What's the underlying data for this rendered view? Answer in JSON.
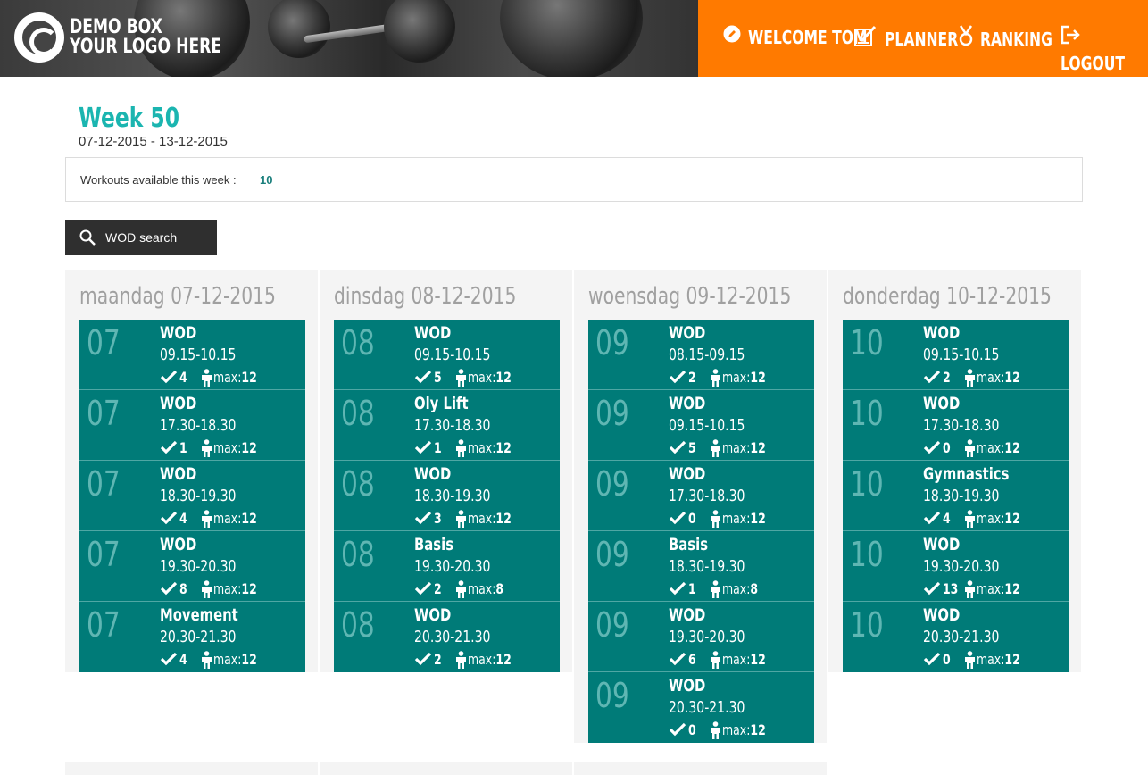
{
  "header": {
    "logo_line1": "DEMO BOX",
    "logo_line2": "YOUR LOGO HERE",
    "nav": [
      {
        "label": "WELCOME TOM",
        "icon": "pencil-icon"
      },
      {
        "label": "PLANNER",
        "icon": "checklist-icon"
      },
      {
        "label": "RANKING",
        "icon": "medal-icon"
      },
      {
        "label": "LOGOUT",
        "icon": "logout-icon"
      }
    ]
  },
  "colors": {
    "accent": "#ff7a00",
    "teal": "#007b78",
    "title": "#1bb5b0"
  },
  "week": {
    "title": "Week 50",
    "range": "07-12-2015 - 13-12-2015",
    "available_label": "Workouts available this week :",
    "available_count": "10"
  },
  "search": {
    "label": "WOD search",
    "icon": "search-icon"
  },
  "days": [
    {
      "title": "maandag 07-12-2015",
      "slots": [
        {
          "day": "07",
          "name": "WOD",
          "time": "09.15-10.15",
          "count": "4",
          "max_label": "max:",
          "max": "12"
        },
        {
          "day": "07",
          "name": "WOD",
          "time": "17.30-18.30",
          "count": "1",
          "max_label": "max:",
          "max": "12"
        },
        {
          "day": "07",
          "name": "WOD",
          "time": "18.30-19.30",
          "count": "4",
          "max_label": "max:",
          "max": "12"
        },
        {
          "day": "07",
          "name": "WOD",
          "time": "19.30-20.30",
          "count": "8",
          "max_label": "max:",
          "max": "12"
        },
        {
          "day": "07",
          "name": "Movement",
          "time": "20.30-21.30",
          "count": "4",
          "max_label": "max:",
          "max": "12"
        }
      ]
    },
    {
      "title": "dinsdag 08-12-2015",
      "slots": [
        {
          "day": "08",
          "name": "WOD",
          "time": "09.15-10.15",
          "count": "5",
          "max_label": "max:",
          "max": "12"
        },
        {
          "day": "08",
          "name": "Oly Lift",
          "time": "17.30-18.30",
          "count": "1",
          "max_label": "max:",
          "max": "12"
        },
        {
          "day": "08",
          "name": "WOD",
          "time": "18.30-19.30",
          "count": "3",
          "max_label": "max:",
          "max": "12"
        },
        {
          "day": "08",
          "name": "Basis",
          "time": "19.30-20.30",
          "count": "2",
          "max_label": "max:",
          "max": "8"
        },
        {
          "day": "08",
          "name": "WOD",
          "time": "20.30-21.30",
          "count": "2",
          "max_label": "max:",
          "max": "12"
        }
      ]
    },
    {
      "title": "woensdag 09-12-2015",
      "slots": [
        {
          "day": "09",
          "name": "WOD",
          "time": "08.15-09.15",
          "count": "2",
          "max_label": "max:",
          "max": "12"
        },
        {
          "day": "09",
          "name": "WOD",
          "time": "09.15-10.15",
          "count": "5",
          "max_label": "max:",
          "max": "12"
        },
        {
          "day": "09",
          "name": "WOD",
          "time": "17.30-18.30",
          "count": "0",
          "max_label": "max:",
          "max": "12"
        },
        {
          "day": "09",
          "name": "Basis",
          "time": "18.30-19.30",
          "count": "1",
          "max_label": "max:",
          "max": "8"
        },
        {
          "day": "09",
          "name": "WOD",
          "time": "19.30-20.30",
          "count": "6",
          "max_label": "max:",
          "max": "12"
        },
        {
          "day": "09",
          "name": "WOD",
          "time": "20.30-21.30",
          "count": "0",
          "max_label": "max:",
          "max": "12"
        }
      ]
    },
    {
      "title": "donderdag 10-12-2015",
      "slots": [
        {
          "day": "10",
          "name": "WOD",
          "time": "09.15-10.15",
          "count": "2",
          "max_label": "max:",
          "max": "12"
        },
        {
          "day": "10",
          "name": "WOD",
          "time": "17.30-18.30",
          "count": "0",
          "max_label": "max:",
          "max": "12"
        },
        {
          "day": "10",
          "name": "Gymnastics",
          "time": "18.30-19.30",
          "count": "4",
          "max_label": "max:",
          "max": "12"
        },
        {
          "day": "10",
          "name": "WOD",
          "time": "19.30-20.30",
          "count": "13",
          "max_label": "max:",
          "max": "12"
        },
        {
          "day": "10",
          "name": "WOD",
          "time": "20.30-21.30",
          "count": "0",
          "max_label": "max:",
          "max": "12"
        }
      ]
    }
  ]
}
